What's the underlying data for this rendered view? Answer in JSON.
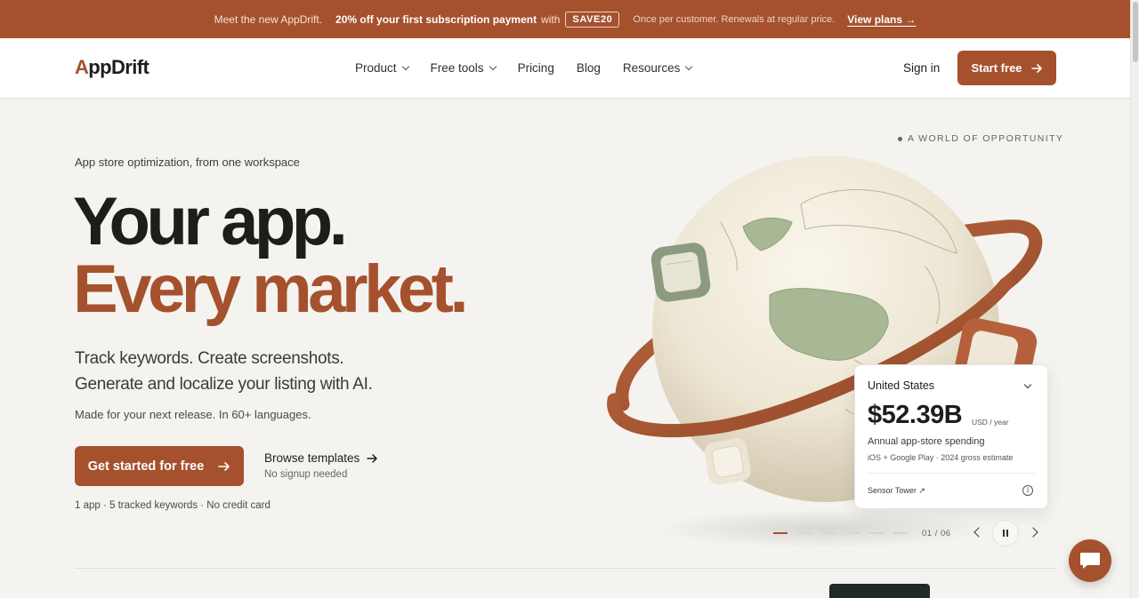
{
  "promo": {
    "lead": "Meet the new AppDrift.",
    "offer": "20% off your first subscription payment",
    "with": "with",
    "code": "SAVE20",
    "fine": "Once per customer. Renewals at regular price.",
    "link": "View plans →"
  },
  "nav": {
    "logo_a": "A",
    "logo_rest": "ppDrift",
    "items": [
      {
        "label": "Product",
        "dropdown": true
      },
      {
        "label": "Free tools",
        "dropdown": true
      },
      {
        "label": "Pricing",
        "dropdown": false
      },
      {
        "label": "Blog",
        "dropdown": false
      },
      {
        "label": "Resources",
        "dropdown": true
      }
    ],
    "signin": "Sign in",
    "start": "Start free"
  },
  "hero": {
    "eyebrow": "App store optimization, from one workspace",
    "headline_1": "Your app.",
    "headline_2": "Every market.",
    "sub_1": "Track keywords. Create screenshots.",
    "sub_2": "Generate and localize your listing with AI.",
    "note": "Made for your next release. In 60+ languages.",
    "cta": "Get started for free",
    "browse": "Browse templates",
    "browse_note": "No signup needed",
    "fine": "1 app · 5 tracked keywords · No credit card"
  },
  "showcase": {
    "kicker": "A WORLD OF OPPORTUNITY",
    "card": {
      "country": "United States",
      "amount": "$52.39B",
      "unit": "USD / year",
      "label": "Annual app-store spending",
      "source": "iOS + Google Play · 2024 gross estimate",
      "provider": "Sensor Tower ↗",
      "info": "i"
    },
    "carousel": {
      "slides": 6,
      "active": 1,
      "pager": "01 / 06"
    }
  },
  "colors": {
    "brand": "#a5512e",
    "background": "#f4f3ef",
    "globe": "#ede6d6",
    "land": "#a8b894"
  },
  "icons": {
    "chat": "chat-bubble-icon",
    "arrow": "arrow-right-icon"
  }
}
